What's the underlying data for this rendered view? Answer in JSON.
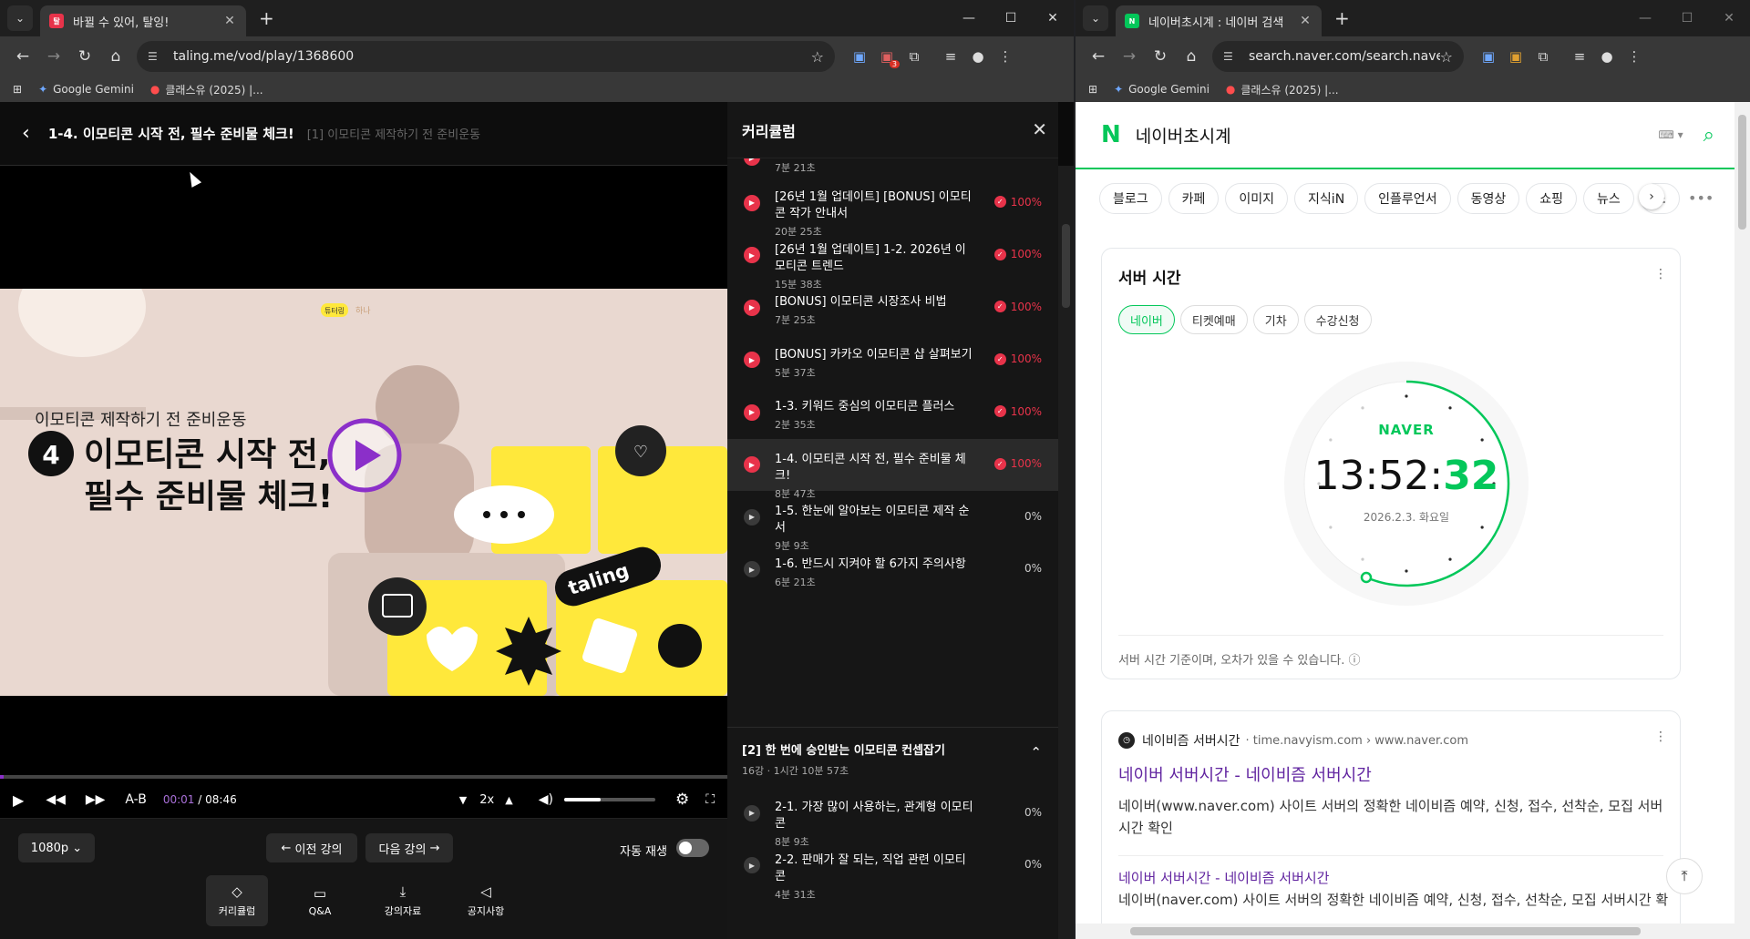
{
  "left_window": {
    "tab": {
      "title": "바뀔 수 있어, 탈잉!",
      "favicon": "탈"
    },
    "url": "taling.me/vod/play/1368600",
    "ext_badge": "3",
    "bookmarks": [
      "Google Gemini",
      "클래스유 (2025) |..."
    ]
  },
  "player": {
    "title": "1-4. 이모티콘 시작 전, 필수 준비물 체크!",
    "subtitle": "[1] 이모티콘 제작하기 전 준비운동",
    "video": {
      "tag_badge": "튜터링",
      "tag_name": "하나",
      "small_line": "이모티콘 제작하기 전 준비운동",
      "number": "4",
      "big_line1": "이모티콘 시작 전,",
      "big_line2": "필수 준비물 체크!",
      "brand": "taling"
    },
    "controls": {
      "ab": "A-B",
      "current": "00:01",
      "sep": "/",
      "total": "08:46",
      "speed": "2x",
      "progress_fraction": 0.002,
      "volume_fraction": 0.4
    },
    "quality": "1080p",
    "prev_label": "이전 강의",
    "next_label": "다음 강의",
    "autoplay_label": "자동 재생",
    "bottom_tabs": [
      "커리큘럼",
      "Q&A",
      "강의자료",
      "공지사항"
    ]
  },
  "curriculum": {
    "title": "커리큘럼",
    "partial_top": "7분 21초",
    "items": [
      {
        "title": "[26년 1월 업데이트] [BONUS] 이모티콘 작가 안내서",
        "duration": "20분 25초",
        "progress": "100%"
      },
      {
        "title": "[26년 1월 업데이트] 1-2. 2026년 이모티콘 트렌드",
        "duration": "15분 38초",
        "progress": "100%"
      },
      {
        "title": "[BONUS] 이모티콘 시장조사 비법",
        "duration": "7분 25초",
        "progress": "100%"
      },
      {
        "title": "[BONUS] 카카오 이모티콘 샵 살펴보기",
        "duration": "5분 37초",
        "progress": "100%"
      },
      {
        "title": "1-3. 키워드 중심의 이모티콘 플러스",
        "duration": "2분 35초",
        "progress": "100%"
      },
      {
        "title": "1-4. 이모티콘 시작 전, 필수 준비물 체크!",
        "duration": "8분 47초",
        "progress": "100%"
      },
      {
        "title": "1-5. 한눈에 알아보는 이모티콘 제작 순서",
        "duration": "9분 9초",
        "progress": "0%"
      },
      {
        "title": "1-6. 반드시 지켜야 할 6가지 주의사항",
        "duration": "6분 21초",
        "progress": "0%"
      }
    ],
    "section2": {
      "title": "[2] 한 번에 승인받는 이모티콘 컨셉잡기",
      "meta": "16강 · 1시간 10분 57초"
    },
    "items2": [
      {
        "title": "2-1. 가장 많이 사용하는, 관계형 이모티콘",
        "duration": "8분 9초",
        "progress": "0%"
      },
      {
        "title": "2-2. 판매가 잘 되는, 직업 관련 이모티콘",
        "duration": "4분 31초",
        "progress": "0%"
      }
    ]
  },
  "right_window": {
    "tab": {
      "title": "네이버초시계 : 네이버 검색",
      "favicon": "N"
    },
    "url": "search.naver.com/search.naver?ie=UTF...",
    "bookmarks": [
      "Google Gemini",
      "클래스유 (2025) |..."
    ],
    "query": "네이버초시계",
    "chips": [
      "블로그",
      "카페",
      "이미지",
      "지식iN",
      "인플루언서",
      "동영상",
      "쇼핑",
      "뉴스",
      "쇼"
    ],
    "server_card": {
      "title": "서버 시간",
      "pills": [
        "네이버",
        "티켓예매",
        "기차",
        "수강신청"
      ],
      "brand": "NAVER",
      "time_hm": "13:52:",
      "time_s": "32",
      "date": "2026.2.3. 화요일",
      "note": "서버 시간 기준이며, 오차가 있을 수 있습니다."
    },
    "result": {
      "site": "네이비즘 서버시간",
      "url": "· time.navyism.com › www.naver.com",
      "title": "네이버 서버시간 - 네이비즘 서버시간",
      "desc": "네이버(www.naver.com) 사이트 서버의 정확한 네이비즘 예약, 신청, 접수, 선착순, 모집 서버시간 확인",
      "title2": "네이버 서버시간 - 네이비즘 서버시간",
      "desc2": "네이버(naver.com) 사이트 서버의 정확한 네이비즘 예약, 신청, 접수, 선착순, 모집 서버시간 확"
    }
  }
}
